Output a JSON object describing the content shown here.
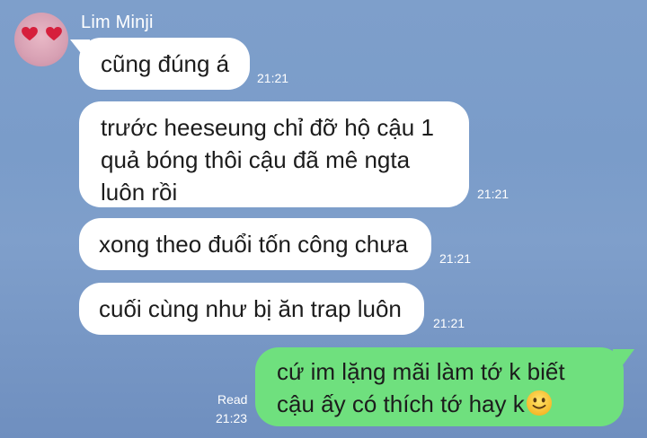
{
  "chat": {
    "contact": {
      "name": "Lim Minji",
      "avatar_icon": "heart-eyes-avatar"
    },
    "messages_in": [
      {
        "lines": [
          "cũng đúng á"
        ],
        "time": "21:21"
      },
      {
        "lines": [
          "trước heeseung chỉ đỡ hộ cậu 1",
          "quả bóng thôi cậu đã mê ngta",
          "luôn rồi"
        ],
        "time": "21:21"
      },
      {
        "lines": [
          "xong theo đuổi tốn công chưa"
        ],
        "time": "21:21"
      },
      {
        "lines": [
          "cuối cùng như bị ăn trap luôn"
        ],
        "time": "21:21"
      }
    ],
    "message_out": {
      "lines": [
        "cứ im lặng mãi làm tớ k biết",
        "cậu ấy có thích tớ hay k"
      ],
      "emoji": "slightly-smiling-face",
      "read_label": "Read",
      "time": "21:23"
    },
    "colors": {
      "background": "#7C9FCC",
      "incoming_bubble": "#FFFFFF",
      "outgoing_bubble": "#6FE07E"
    }
  }
}
